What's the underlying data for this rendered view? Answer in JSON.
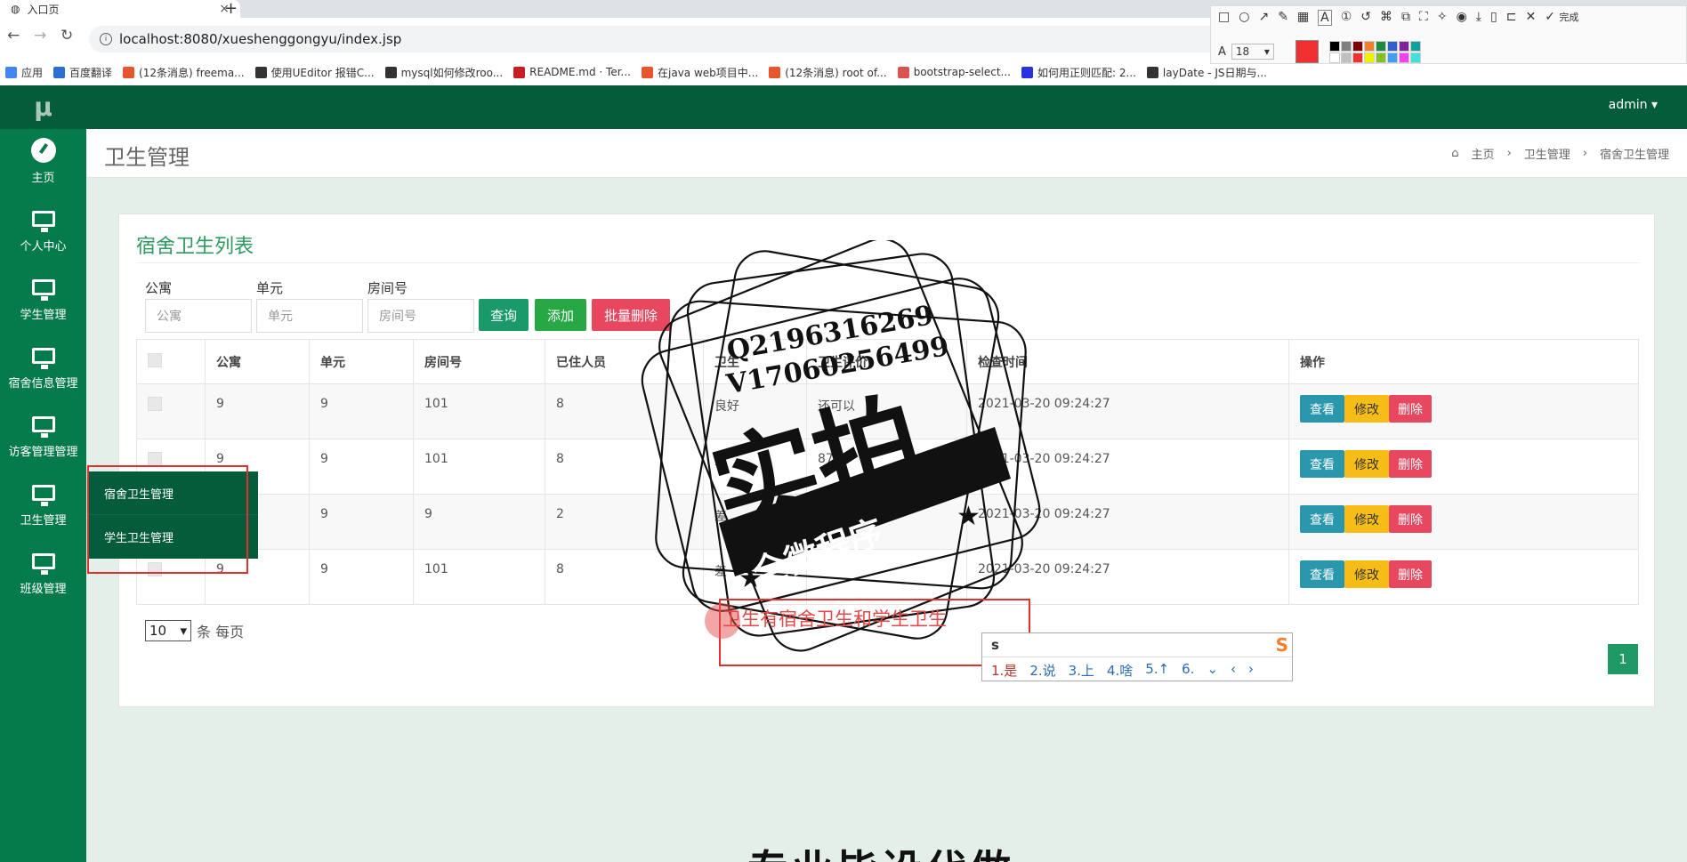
{
  "browser": {
    "tab_title": "入口页",
    "url": "localhost:8080/xueshenggongyu/index.jsp",
    "bookmarks": [
      {
        "label": "应用",
        "color": "#4285f4"
      },
      {
        "label": "百度翻译",
        "color": "#2a6fd6"
      },
      {
        "label": "(12条消息) freema...",
        "color": "#e8542d"
      },
      {
        "label": "使用UEditor 报错C...",
        "color": "#333333"
      },
      {
        "label": "mysql如何修改roo...",
        "color": "#333333"
      },
      {
        "label": "README.md · Ter...",
        "color": "#c71d23"
      },
      {
        "label": "在java web项目中...",
        "color": "#e8542d"
      },
      {
        "label": "(12条消息) root of...",
        "color": "#e8542d"
      },
      {
        "label": "bootstrap-select...",
        "color": "#d9534f"
      },
      {
        "label": "如何用正则匹配: 2...",
        "color": "#2932e1"
      },
      {
        "label": "layDate - JS日期与...",
        "color": "#333333"
      }
    ]
  },
  "annot_toolbar": {
    "done_label": "完成",
    "font_size": "18",
    "colors": [
      "#000000",
      "#808080",
      "#800000",
      "#f08030",
      "#1f8b3a",
      "#3060d0",
      "#8020a0",
      "#10a0a0",
      "#ffffff",
      "#c0c0c0",
      "#f03030",
      "#f0f000",
      "#80c020",
      "#40a0f0",
      "#f040f0",
      "#40e0e0"
    ]
  },
  "app": {
    "logo": "μ",
    "user": "admin",
    "nav": [
      {
        "label": "主页",
        "icon": "dashboard-icon"
      },
      {
        "label": "个人中心",
        "icon": "monitor-icon"
      },
      {
        "label": "学生管理",
        "icon": "monitor-icon"
      },
      {
        "label": "宿舍信息管理",
        "icon": "monitor-icon"
      },
      {
        "label": "访客管理管理",
        "icon": "monitor-icon"
      },
      {
        "label": "卫生管理",
        "icon": "monitor-icon"
      },
      {
        "label": "班级管理",
        "icon": "monitor-icon"
      }
    ],
    "submenu": [
      "宿舍卫生管理",
      "学生卫生管理"
    ]
  },
  "page": {
    "title": "卫生管理",
    "breadcrumb": [
      "主页",
      "卫生管理",
      "宿舍卫生管理"
    ]
  },
  "card": {
    "title": "宿舍卫生列表",
    "filters": [
      {
        "label": "公寓",
        "placeholder": "公寓"
      },
      {
        "label": "单元",
        "placeholder": "单元"
      },
      {
        "label": "房间号",
        "placeholder": "房间号"
      }
    ],
    "buttons": {
      "query": "查询",
      "add": "添加",
      "batch_delete": "批量删除"
    },
    "columns": [
      "公寓",
      "单元",
      "房间号",
      "已住人员",
      "卫生",
      "卫生评价",
      "检查时间",
      "操作"
    ],
    "rows": [
      {
        "gongyu": "9",
        "danyuan": "9",
        "fangjian": "101",
        "renyuan": "8",
        "weisheng": "良好",
        "pingjia": "还可以",
        "time": "2021-03-20 09:24:27"
      },
      {
        "gongyu": "9",
        "danyuan": "9",
        "fangjian": "101",
        "renyuan": "8",
        "weisheng": "差",
        "pingjia": "87",
        "time": "2021-03-20 09:24:27"
      },
      {
        "gongyu": "9",
        "danyuan": "9",
        "fangjian": "9",
        "renyuan": "2",
        "weisheng": "差",
        "pingjia": "897",
        "time": "2021-03-20 09:24:27"
      },
      {
        "gongyu": "9",
        "danyuan": "9",
        "fangjian": "101",
        "renyuan": "8",
        "weisheng": "差",
        "pingjia": "",
        "time": "2021-03-20 09:24:27"
      }
    ],
    "row_actions": {
      "view": "查看",
      "edit": "修改",
      "delete": "删除"
    },
    "page_size": "10",
    "page_size_suffix": "条 每页",
    "current_page": "1"
  },
  "overlay": {
    "watermark_lines": [
      "Q2196316269",
      "V17060256499"
    ],
    "watermark_main": "实拍",
    "watermark_banner": "全微程序",
    "typed_text": "卫生有宿舍卫生和学生卫生",
    "ime_input": "s",
    "ime_candidates": [
      "1.是",
      "2.说",
      "3.上",
      "4.啥",
      "5.↑",
      "6.",
      "⌄",
      "‹",
      "›"
    ],
    "bottom_text": "专业毕设代做"
  }
}
